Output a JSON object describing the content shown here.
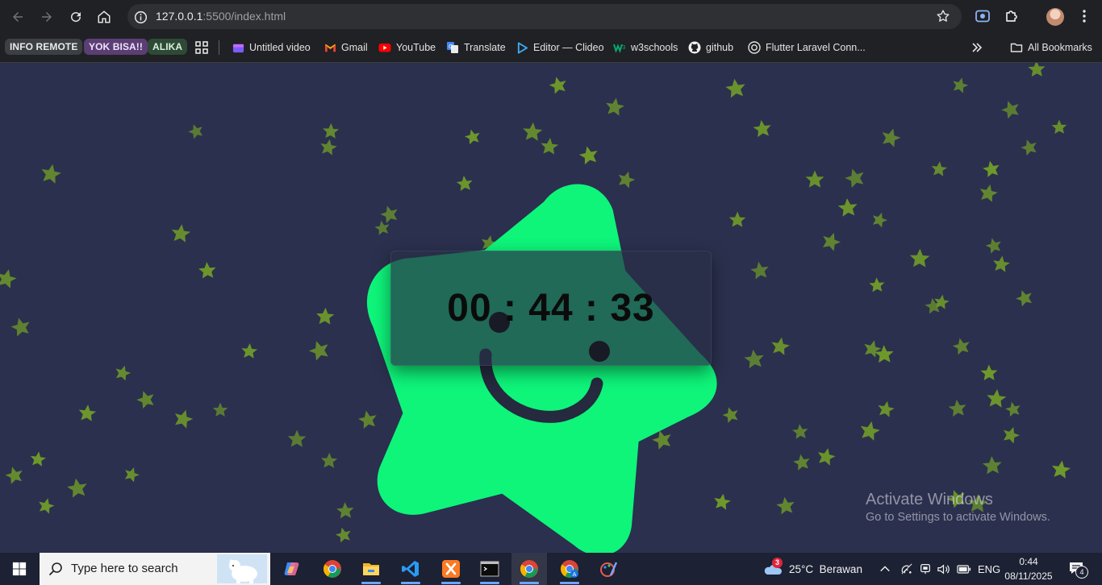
{
  "browser": {
    "url_host": "127.0.0.1",
    "url_path": ":5500/index.html",
    "icons": [
      "back-icon",
      "forward-icon",
      "reload-icon",
      "home-icon",
      "site-info-icon",
      "bookmark-star-icon",
      "screenshot-icon",
      "extensions-icon",
      "profile-avatar",
      "menu-icon"
    ]
  },
  "bookmarks": {
    "groups": [
      {
        "label": "INFO REMOTE",
        "bg": "#3c4043",
        "fg": "#e8eaed"
      },
      {
        "label": "YOK BISA!!",
        "bg": "#5b3e74",
        "fg": "#efe2fb"
      },
      {
        "label": "ALIKA",
        "bg": "#2e4a36",
        "fg": "#d7f0dc"
      }
    ],
    "items": [
      {
        "label": "Untitled video",
        "icon": "clipchamp-icon"
      },
      {
        "label": "Gmail",
        "icon": "gmail-icon"
      },
      {
        "label": "YouTube",
        "icon": "youtube-icon"
      },
      {
        "label": "Translate",
        "icon": "translate-icon"
      },
      {
        "label": "Editor — Clideo",
        "icon": "clideo-icon"
      },
      {
        "label": "w3schools",
        "icon": "w3schools-icon"
      },
      {
        "label": "github",
        "icon": "github-icon"
      },
      {
        "label": "Flutter Laravel Conn...",
        "icon": "globe-icon"
      }
    ],
    "all_bookmarks": "All Bookmarks"
  },
  "page": {
    "timer": "00 : 44 : 33",
    "star_color": "#0ef57a",
    "bg_color": "#2b304e",
    "small_star_color": "#6f9a2a"
  },
  "watermark": {
    "line1": "Activate Windows",
    "line2": "Go to Settings to activate Windows."
  },
  "taskbar": {
    "search_placeholder": "Type here to search",
    "apps": [
      "copilot-icon",
      "chrome-icon",
      "file-explorer-icon",
      "vscode-icon",
      "xampp-icon",
      "terminal-icon",
      "chrome-icon",
      "chrome-profile-icon",
      "paint-icon"
    ],
    "weather_badge": "3",
    "weather": "25°C  Berawan",
    "lang": "ENG",
    "time": "0:44",
    "date": "08/11/2025",
    "notif_count": "4"
  }
}
